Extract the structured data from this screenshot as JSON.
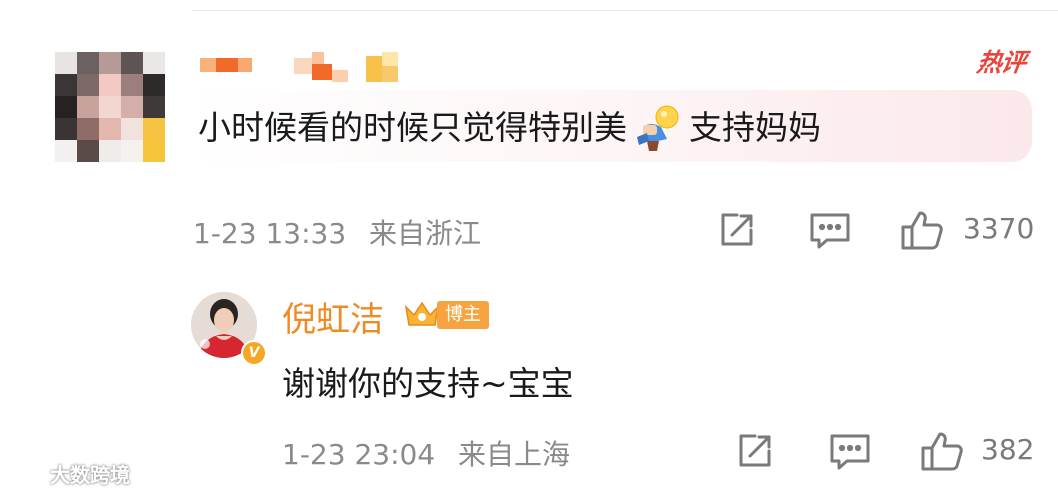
{
  "comment": {
    "hot_label": "热评",
    "text_before_emoji": "小时候看的时候只觉得特别美",
    "emoji": "idea-emoji",
    "text_after_emoji": "支持妈妈",
    "timestamp": "1-23 13:33",
    "location": "来自浙江",
    "like_count": "3370"
  },
  "reply": {
    "author": "倪虹洁",
    "badge": "博主",
    "text": "谢谢你的支持~宝宝",
    "timestamp": "1-23 23:04",
    "location": "来自上海",
    "like_count": "382"
  },
  "icons": {
    "share": "share-icon",
    "comment": "comment-icon",
    "like": "like-icon"
  },
  "watermark": "大数跨境",
  "colors": {
    "hot": "#e8453c",
    "author": "#f08a24",
    "meta": "#8a8a8a",
    "badge": "#f6a340"
  }
}
